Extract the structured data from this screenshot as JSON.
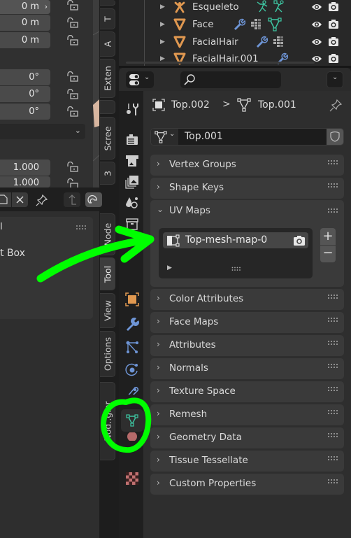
{
  "left_panel": {
    "location_fields": [
      "0 m",
      "0 m",
      "0 m"
    ],
    "rotation_fields": [
      "0°",
      "0°",
      "0°"
    ],
    "scale_fields": [
      "1.000",
      "1.000"
    ],
    "tool_panel": {
      "header_fragment": "l",
      "item_fragment": "t Box"
    }
  },
  "vertical_tabs": [
    "T",
    "A",
    "Exten",
    "Scree",
    "3",
    "Node",
    "Tool",
    "View",
    "Options",
    "Node Wrangler"
  ],
  "vertical_tabs_display": [
    "T",
    "A",
    "Exten",
    "Scree",
    "3",
    "Node",
    "Tool",
    "View",
    "Options",
    "Nod..gler"
  ],
  "outliner": {
    "rows": [
      {
        "name": "Esqueleto",
        "type": "armature",
        "extra_icons": [
          "pose-icon",
          "armature-data-icon"
        ]
      },
      {
        "name": "Face",
        "type": "mesh",
        "extra_icons": [
          "modifier-icon",
          "vertex-groups-icon",
          "mesh-data-icon"
        ]
      },
      {
        "name": "FacialHair",
        "type": "mesh",
        "extra_icons": [
          "modifier-icon",
          "vertex-groups-icon"
        ]
      },
      {
        "name": "FacialHair.001",
        "type": "mesh",
        "extra_icons": [
          "modifier-icon"
        ]
      }
    ]
  },
  "properties": {
    "search_placeholder": "",
    "breadcrumb": {
      "object": "Top.002",
      "separator": ">",
      "data": "Top.001"
    },
    "datablock_name": "Top.001",
    "panels": [
      {
        "title": "Vertex Groups",
        "expanded": false
      },
      {
        "title": "Shape Keys",
        "expanded": false
      },
      {
        "title": "UV Maps",
        "expanded": true
      },
      {
        "title": "Color Attributes",
        "expanded": false
      },
      {
        "title": "Face Maps",
        "expanded": false
      },
      {
        "title": "Attributes",
        "expanded": false
      },
      {
        "title": "Normals",
        "expanded": false
      },
      {
        "title": "Texture Space",
        "expanded": false
      },
      {
        "title": "Remesh",
        "expanded": false
      },
      {
        "title": "Geometry Data",
        "expanded": false
      },
      {
        "title": "Tissue Tessellate",
        "expanded": false
      },
      {
        "title": "Custom Properties",
        "expanded": false
      }
    ],
    "uv_maps": {
      "items": [
        {
          "name": "Top-mesh-map-0",
          "active_render": true
        }
      ],
      "add_label": "+",
      "remove_label": "−"
    },
    "tabs": [
      "tool",
      "render",
      "output",
      "view-layer",
      "scene",
      "world",
      "object",
      "modifiers",
      "particles",
      "physics",
      "constraints",
      "data",
      "material",
      "texture"
    ],
    "active_tab": "data"
  },
  "annotations": {
    "color": "#00ff00",
    "arrow": "points to UV map list",
    "circle": "around Object Data (mesh) tab"
  },
  "colors": {
    "mesh_orange": "#e09850",
    "data_green": "#3ec7a3",
    "modifier_blue": "#6e95d6",
    "accent_annotation": "#00ff00"
  }
}
